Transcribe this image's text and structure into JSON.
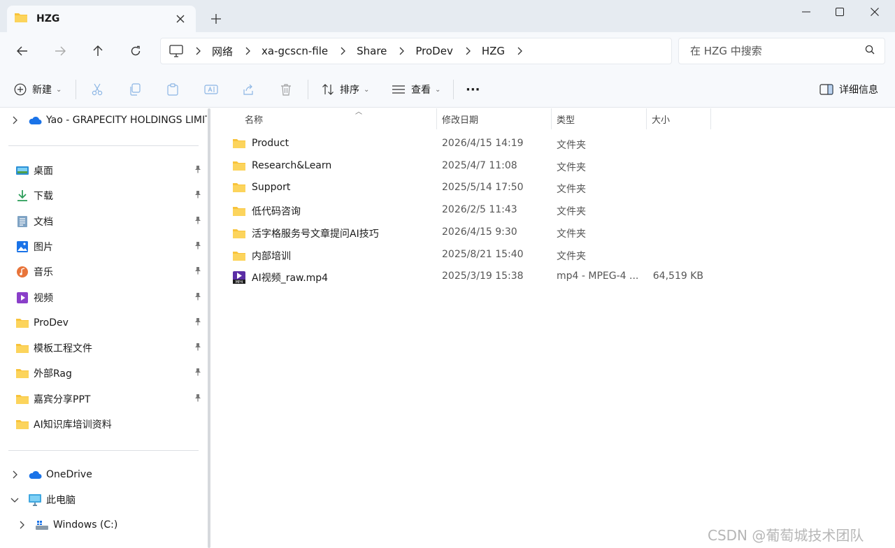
{
  "window": {
    "tab_title": "HZG",
    "new_tab": "+"
  },
  "nav": {
    "crumbs": [
      "网络",
      "xa-gcscn-file",
      "Share",
      "ProDev",
      "HZG"
    ]
  },
  "search": {
    "placeholder": "在 HZG 中搜索"
  },
  "commands": {
    "new_label": "新建",
    "sort_label": "排序",
    "view_label": "查看",
    "more_label": "···",
    "details_label": "详细信息"
  },
  "sidebar": {
    "top": {
      "label": "Yao - GRAPECITY HOLDINGS LIMIT"
    },
    "pinned": [
      {
        "label": "桌面",
        "icon": "desktop-icon"
      },
      {
        "label": "下载",
        "icon": "download-icon"
      },
      {
        "label": "文档",
        "icon": "document-icon"
      },
      {
        "label": "图片",
        "icon": "pictures-icon"
      },
      {
        "label": "音乐",
        "icon": "music-icon"
      },
      {
        "label": "视频",
        "icon": "videos-icon"
      },
      {
        "label": "ProDev",
        "icon": "folder-icon"
      },
      {
        "label": "模板工程文件",
        "icon": "folder-icon"
      },
      {
        "label": "外部Rag",
        "icon": "folder-icon"
      },
      {
        "label": "嘉宾分享PPT",
        "icon": "folder-icon"
      },
      {
        "label": "AI知识库培训资料",
        "icon": "folder-icon"
      }
    ],
    "onedrive": {
      "label": "OneDrive"
    },
    "thispc": {
      "label": "此电脑"
    },
    "windows": {
      "label": "Windows (C:)"
    }
  },
  "columns": {
    "name": "名称",
    "date": "修改日期",
    "type": "类型",
    "size": "大小"
  },
  "files": [
    {
      "name": "Product",
      "date": "2026/4/15 14:19",
      "type": "文件夹",
      "size": "",
      "kind": "folder"
    },
    {
      "name": "Research&Learn",
      "date": "2025/4/7 11:08",
      "type": "文件夹",
      "size": "",
      "kind": "folder"
    },
    {
      "name": "Support",
      "date": "2025/5/14 17:50",
      "type": "文件夹",
      "size": "",
      "kind": "folder"
    },
    {
      "name": "低代码咨询",
      "date": "2026/2/5 11:43",
      "type": "文件夹",
      "size": "",
      "kind": "folder"
    },
    {
      "name": "活字格服务号文章提问AI技巧",
      "date": "2026/4/15 9:30",
      "type": "文件夹",
      "size": "",
      "kind": "folder"
    },
    {
      "name": "内部培训",
      "date": "2025/8/21 15:40",
      "type": "文件夹",
      "size": "",
      "kind": "folder"
    },
    {
      "name": "AI视频_raw.mp4",
      "date": "2025/3/19 15:38",
      "type": "mp4 - MPEG-4 ...",
      "size": "64,519 KB",
      "kind": "video"
    }
  ],
  "watermark": "CSDN @葡萄城技术团队",
  "colors": {
    "folder": "#f8c33a",
    "accent": "#0a64c8",
    "video": "#5b2ea6"
  }
}
